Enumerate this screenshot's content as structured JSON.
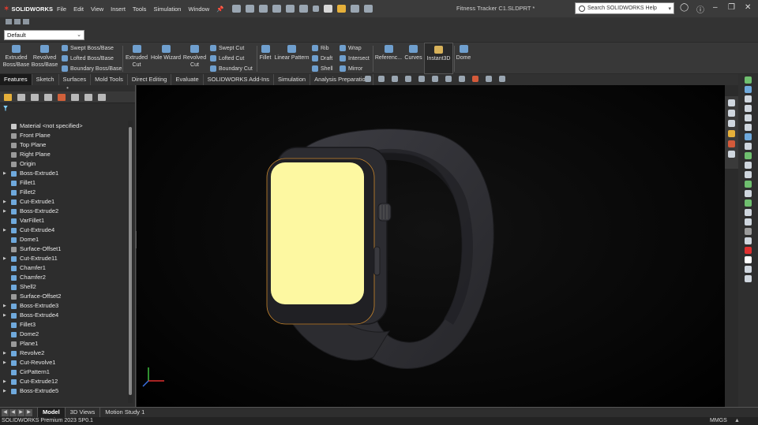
{
  "app": {
    "brand": "SOLIDWORKS",
    "document_title": "Fitness Tracker C1.SLDPRT *",
    "search_placeholder": "Search SOLIDWORKS Help",
    "config": "Default"
  },
  "menu": [
    "File",
    "Edit",
    "View",
    "Insert",
    "Tools",
    "Simulation",
    "Window"
  ],
  "commands": {
    "extruded_boss": "Extruded Boss/Base",
    "revolved_boss": "Revolved Boss/Base",
    "swept_boss": "Swept Boss/Base",
    "lofted_boss": "Lofted Boss/Base",
    "boundary_boss": "Boundary Boss/Base",
    "extruded_cut": "Extruded Cut",
    "hole_wizard": "Hole Wizard",
    "revolved_cut": "Revolved Cut",
    "swept_cut": "Swept Cut",
    "lofted_cut": "Lofted Cut",
    "boundary_cut": "Boundary Cut",
    "fillet": "Fillet",
    "linear_pattern": "Linear Pattern",
    "rib": "Rib",
    "draft": "Draft",
    "shell": "Shell",
    "wrap": "Wrap",
    "intersect": "Intersect",
    "mirror": "Mirror",
    "reference": "Referenc...",
    "curves": "Curves",
    "instant3d": "Instant3D",
    "dome": "Dome"
  },
  "tabs": [
    "Features",
    "Sketch",
    "Surfaces",
    "Mold Tools",
    "Direct Editing",
    "Evaluate",
    "SOLIDWORKS Add-Ins",
    "Simulation",
    "Analysis Preparation"
  ],
  "tree": [
    {
      "label": "Material <not specified>",
      "expand": false,
      "icon": "material-icon",
      "color": "#c9c9c9"
    },
    {
      "label": "Front Plane",
      "expand": false,
      "icon": "plane-icon",
      "color": "#9a9a9a"
    },
    {
      "label": "Top Plane",
      "expand": false,
      "icon": "plane-icon",
      "color": "#9a9a9a"
    },
    {
      "label": "Right Plane",
      "expand": false,
      "icon": "plane-icon",
      "color": "#9a9a9a"
    },
    {
      "label": "Origin",
      "expand": false,
      "icon": "origin-icon",
      "color": "#9a9a9a"
    },
    {
      "label": "Boss-Extrude1",
      "expand": true,
      "icon": "feature-icon",
      "color": "#6fa9dc"
    },
    {
      "label": "Fillet1",
      "expand": false,
      "icon": "feature-icon",
      "color": "#6fa9dc"
    },
    {
      "label": "Fillet2",
      "expand": false,
      "icon": "feature-icon",
      "color": "#6fa9dc"
    },
    {
      "label": "Cut-Extrude1",
      "expand": true,
      "icon": "feature-icon",
      "color": "#6fa9dc"
    },
    {
      "label": "Boss-Extrude2",
      "expand": true,
      "icon": "feature-icon",
      "color": "#6fa9dc"
    },
    {
      "label": "VarFillet1",
      "expand": false,
      "icon": "feature-icon",
      "color": "#6fa9dc"
    },
    {
      "label": "Cut-Extrude4",
      "expand": true,
      "icon": "feature-icon",
      "color": "#6fa9dc"
    },
    {
      "label": "Dome1",
      "expand": false,
      "icon": "feature-icon",
      "color": "#6fa9dc"
    },
    {
      "label": "Surface-Offset1",
      "expand": false,
      "icon": "surface-icon",
      "color": "#9a9a9a"
    },
    {
      "label": "Cut-Extrude11",
      "expand": true,
      "icon": "feature-icon",
      "color": "#6fa9dc"
    },
    {
      "label": "Chamfer1",
      "expand": false,
      "icon": "feature-icon",
      "color": "#6fa9dc"
    },
    {
      "label": "Chamfer2",
      "expand": false,
      "icon": "feature-icon",
      "color": "#6fa9dc"
    },
    {
      "label": "Shell2",
      "expand": false,
      "icon": "feature-icon",
      "color": "#6fa9dc"
    },
    {
      "label": "Surface-Offset2",
      "expand": false,
      "icon": "surface-icon",
      "color": "#9a9a9a"
    },
    {
      "label": "Boss-Extrude3",
      "expand": true,
      "icon": "feature-icon",
      "color": "#6fa9dc"
    },
    {
      "label": "Boss-Extrude4",
      "expand": true,
      "icon": "feature-icon",
      "color": "#6fa9dc"
    },
    {
      "label": "Fillet3",
      "expand": false,
      "icon": "feature-icon",
      "color": "#6fa9dc"
    },
    {
      "label": "Dome2",
      "expand": false,
      "icon": "feature-icon",
      "color": "#6fa9dc"
    },
    {
      "label": "Plane1",
      "expand": false,
      "icon": "plane-icon",
      "color": "#9a9a9a"
    },
    {
      "label": "Revolve2",
      "expand": true,
      "icon": "feature-icon",
      "color": "#6fa9dc"
    },
    {
      "label": "Cut-Revolve1",
      "expand": true,
      "icon": "feature-icon",
      "color": "#6fa9dc"
    },
    {
      "label": "CirPattern1",
      "expand": false,
      "icon": "feature-icon",
      "color": "#6fa9dc"
    },
    {
      "label": "Cut-Extrude12",
      "expand": true,
      "icon": "feature-icon",
      "color": "#6fa9dc"
    },
    {
      "label": "Boss-Extrude5",
      "expand": true,
      "icon": "feature-icon",
      "color": "#6fa9dc"
    }
  ],
  "bottom_tabs": [
    "Model",
    "3D Views",
    "Motion Study 1"
  ],
  "status": {
    "product": "SOLIDWORKS Premium 2023 SP0.1",
    "units": "MMGS"
  },
  "colors": {
    "screen": "#fdf8a1",
    "case": "#2b2b2f",
    "band": "#343438",
    "accent_edge": "#d48b2a"
  }
}
